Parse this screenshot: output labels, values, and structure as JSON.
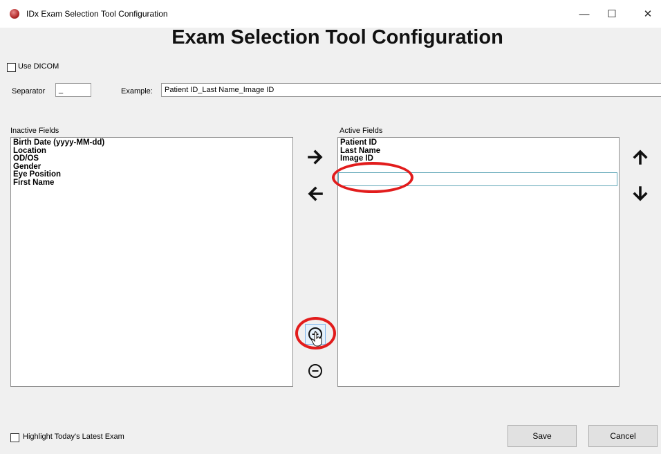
{
  "window": {
    "title": "IDx Exam Selection Tool Configuration",
    "controls": {
      "minimize": "—",
      "maximize": "☐",
      "close": "✕"
    }
  },
  "heading": "Exam Selection Tool Configuration",
  "use_dicom": {
    "label": "Use DICOM",
    "checked": false
  },
  "separator": {
    "label": "Separator",
    "value": "_"
  },
  "example": {
    "label": "Example:",
    "value": "Patient ID_Last Name_Image ID"
  },
  "inactive_fields": {
    "label": "Inactive Fields",
    "items": [
      "Birth Date (yyyy-MM-dd)",
      "Location",
      "OD/OS",
      "Gender",
      "Eye Position",
      "First Name"
    ]
  },
  "active_fields": {
    "label": "Active Fields",
    "items": [
      "Patient ID",
      "Last Name",
      "Image ID"
    ],
    "new_item_value": ""
  },
  "icons": {
    "move_right": "arrow-right-icon",
    "move_left": "arrow-left-icon",
    "move_up": "arrow-up-icon",
    "move_down": "arrow-down-icon",
    "add": "plus-circle-icon",
    "remove": "minus-circle-icon"
  },
  "highlight_latest": {
    "label": "Highlight Today's Latest Exam",
    "checked": false
  },
  "buttons": {
    "save": "Save",
    "cancel": "Cancel"
  },
  "colors": {
    "annotation": "#e21c1c",
    "edit_border": "#5aa3b5"
  }
}
